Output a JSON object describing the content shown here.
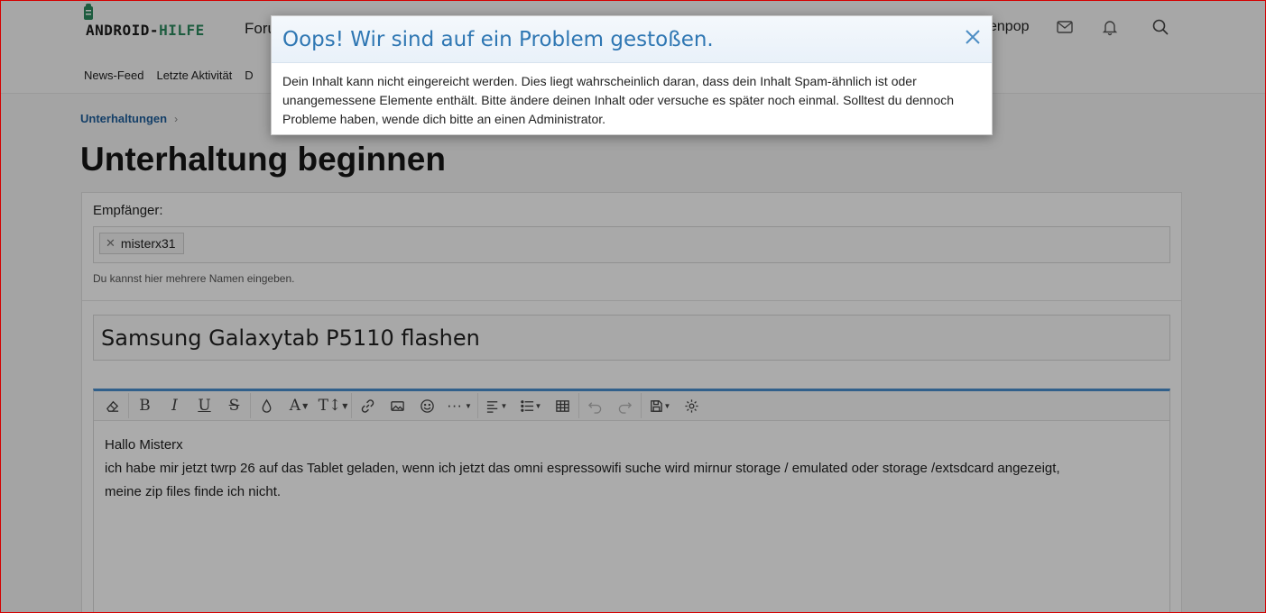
{
  "header": {
    "logo_part1": "ANDROID-",
    "logo_part2": "HILFE",
    "nav_partial": "Foru",
    "user_partial": "enpop",
    "subnav": [
      "News-Feed",
      "Letzte Aktivität",
      "D"
    ]
  },
  "breadcrumb": {
    "item": "Unterhaltungen"
  },
  "page": {
    "title": "Unterhaltung beginnen"
  },
  "form": {
    "recipients_label": "Empfänger:",
    "recipient_tag": "misterx31",
    "recipients_hint": "Du kannst hier mehrere Namen eingeben.",
    "title_value": "Samsung Galaxytab P5110 flashen",
    "editor_lines": [
      "Hallo Misterx",
      "ich habe mir jetzt twrp 26 auf das Tablet geladen, wenn ich jetzt das omni espressowifi suche wird mirnur storage / emulated oder storage /extsdcard angezeigt,",
      "meine zip files finde ich nicht."
    ]
  },
  "modal": {
    "title": "Oops! Wir sind auf ein Problem gestoßen.",
    "message": "Dein Inhalt kann nicht eingereicht werden. Dies liegt wahrscheinlich daran, dass dein Inhalt Spam-ähnlich ist oder unangemessene Elemente enthält. Bitte ändere deinen Inhalt oder versuche es später noch einmal. Solltest du dennoch Probleme haben, wende dich bitte an einen Administrator."
  },
  "colors": {
    "accent": "#2f77b3",
    "logo_green": "#2c8a5e",
    "editor_border": "#4a8fd0",
    "frame": "#d40000"
  }
}
